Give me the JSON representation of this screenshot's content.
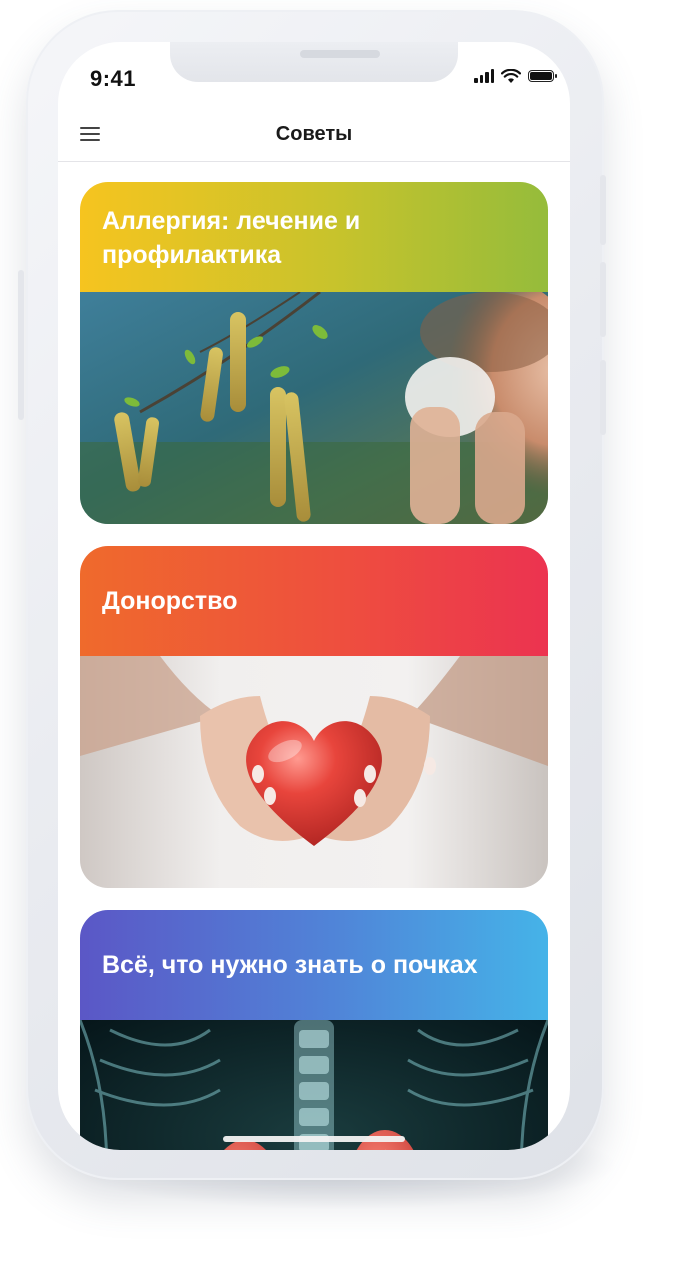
{
  "status_bar": {
    "time": "9:41"
  },
  "nav": {
    "title": "Советы",
    "menu_icon": "hamburger-menu-icon"
  },
  "cards": [
    {
      "title": "Аллергия: лечение и профилактика",
      "gradient": [
        "#f4c520",
        "#9bbf3a"
      ],
      "image": "birch-catkins-sneezing-photo"
    },
    {
      "title": "Донорство",
      "gradient": [
        "#ee6a2e",
        "#ee3350"
      ],
      "image": "hands-holding-heart-photo"
    },
    {
      "title": "Всё, что нужно знать о почках",
      "gradient": [
        "#5d5cc8",
        "#46aee6"
      ],
      "image": "kidneys-xray-photo"
    }
  ]
}
